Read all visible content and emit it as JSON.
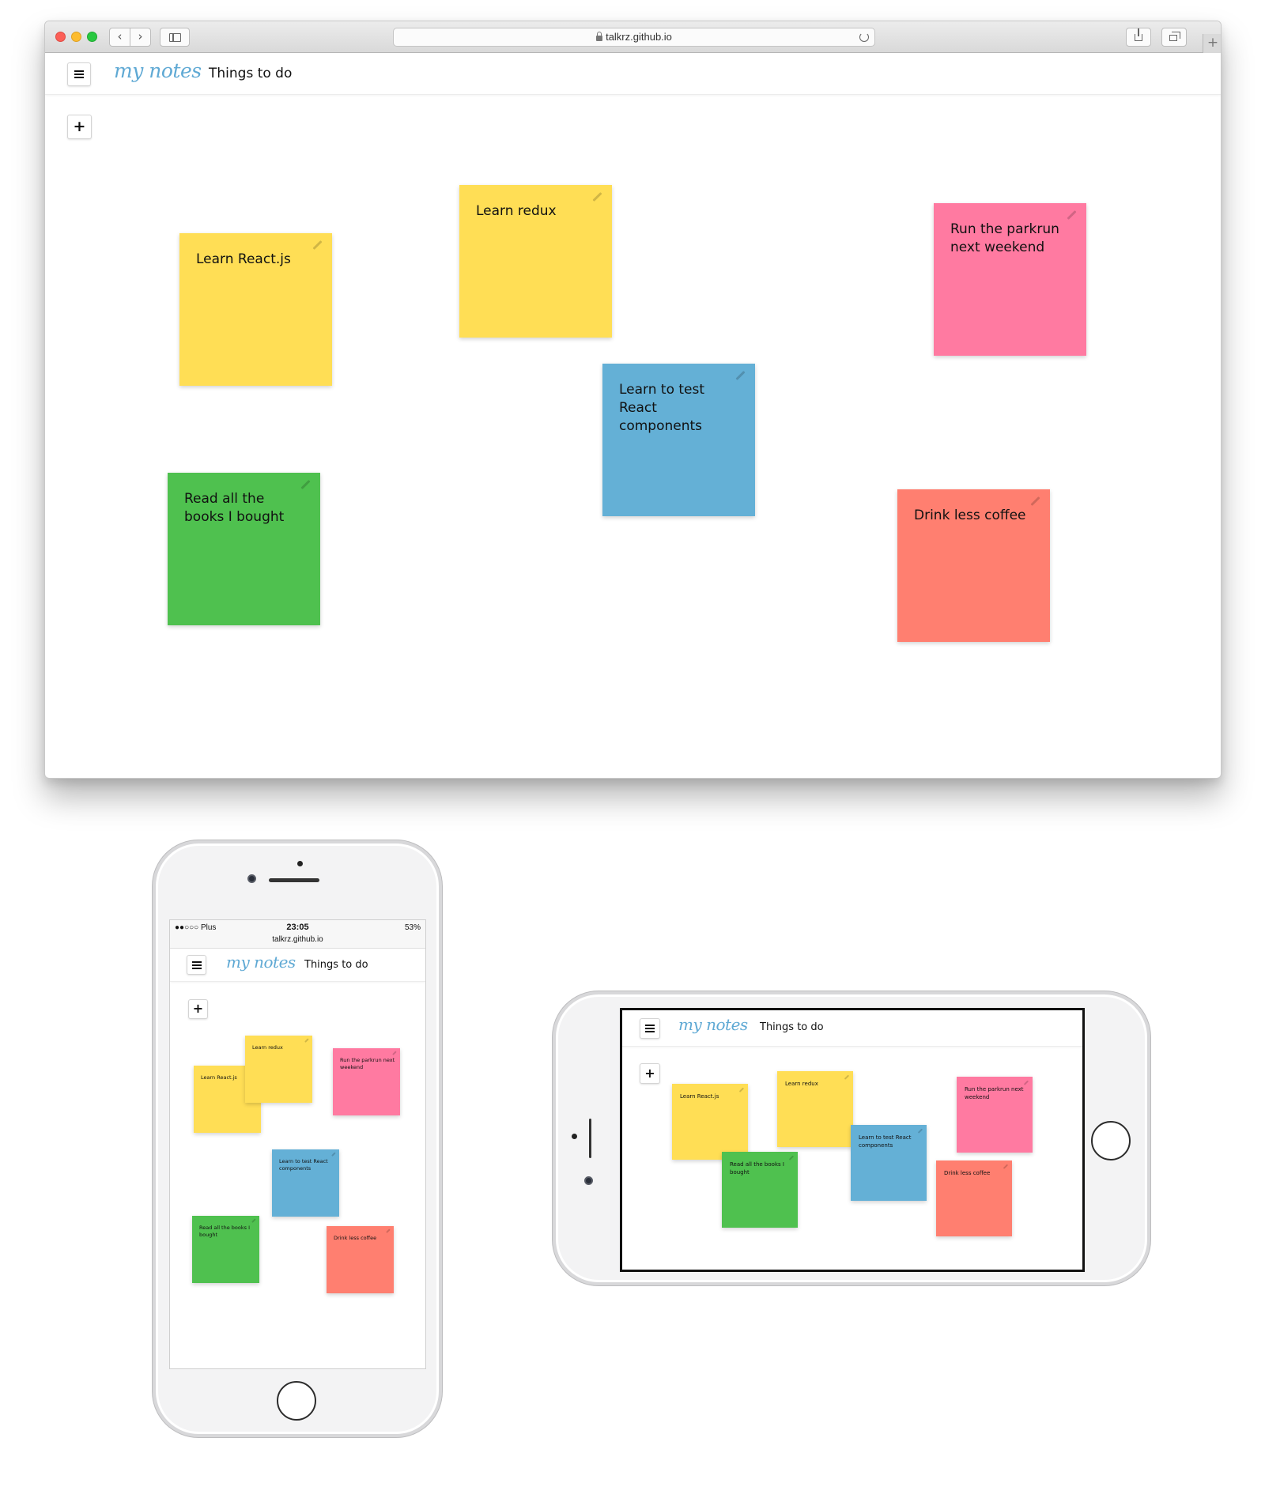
{
  "browser": {
    "url": "talkrz.github.io",
    "nav_back": "‹",
    "nav_forward": "›",
    "new_tab": "+"
  },
  "app": {
    "logo": "my notes",
    "board_title": "Things to do",
    "add_label": "+"
  },
  "notes": [
    {
      "id": "learn-react",
      "text": "Learn React.js",
      "color": "#ffde55"
    },
    {
      "id": "learn-redux",
      "text": "Learn redux",
      "color": "#ffde55"
    },
    {
      "id": "parkrun",
      "text": "Run the parkrun next weekend",
      "color": "#ff7aa1"
    },
    {
      "id": "test-react",
      "text": "Learn to test React components",
      "color": "#64b0d6"
    },
    {
      "id": "read-books",
      "text": "Read all the books I bought",
      "color": "#4fc14f"
    },
    {
      "id": "less-coffee",
      "text": "Drink less coffee",
      "color": "#ff7f70"
    }
  ],
  "phone_status": {
    "carrier": "●●○○○ Plus",
    "time": "23:05",
    "battery": "53%",
    "url": "talkrz.github.io"
  },
  "icons": {
    "menu": "hamburger-menu-icon",
    "add": "plus-icon",
    "edit": "pencil-icon",
    "lock": "lock-icon",
    "reload": "reload-icon",
    "share": "share-icon",
    "tabs": "tabs-icon"
  }
}
